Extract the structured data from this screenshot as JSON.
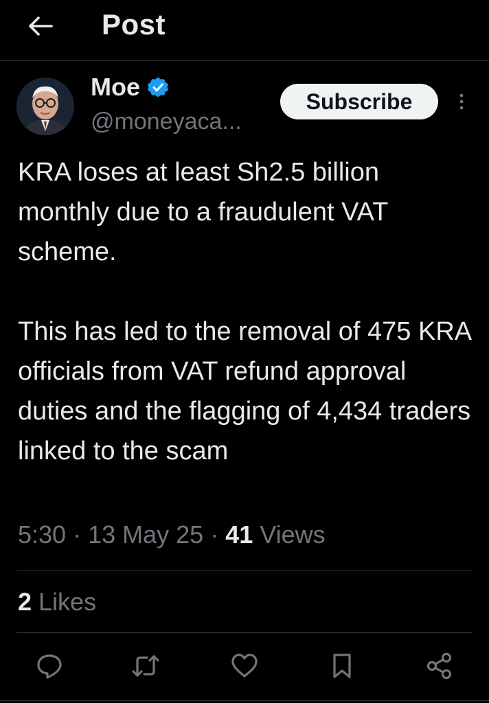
{
  "header": {
    "title": "Post"
  },
  "author": {
    "name": "Moe",
    "handle": "@moneyaca..."
  },
  "buttons": {
    "subscribe": "Subscribe"
  },
  "tweet": {
    "paragraph1": "KRA loses at least Sh2.5 billion monthly due to a fraudulent VAT scheme.",
    "paragraph2": "This has led to the removal of 475 KRA officials from VAT refund approval duties and the flagging of 4,434 traders linked to the scam"
  },
  "meta": {
    "time": "5:30",
    "sep1": " · ",
    "date": "13 May 25",
    "sep2": " · ",
    "views_count": "41",
    "views_label": " Views"
  },
  "stats": {
    "likes_count": "2",
    "likes_label": " Likes"
  },
  "icons": {
    "back": "arrow-left-icon",
    "verified": "verified-badge-icon",
    "more": "more-vertical-icon",
    "reply": "reply-icon",
    "repost": "repost-icon",
    "like": "heart-icon",
    "bookmark": "bookmark-icon",
    "share": "share-icon"
  },
  "colors": {
    "background": "#000000",
    "text": "#e7e9ea",
    "muted": "#71767b",
    "verified": "#1d9bf0"
  }
}
